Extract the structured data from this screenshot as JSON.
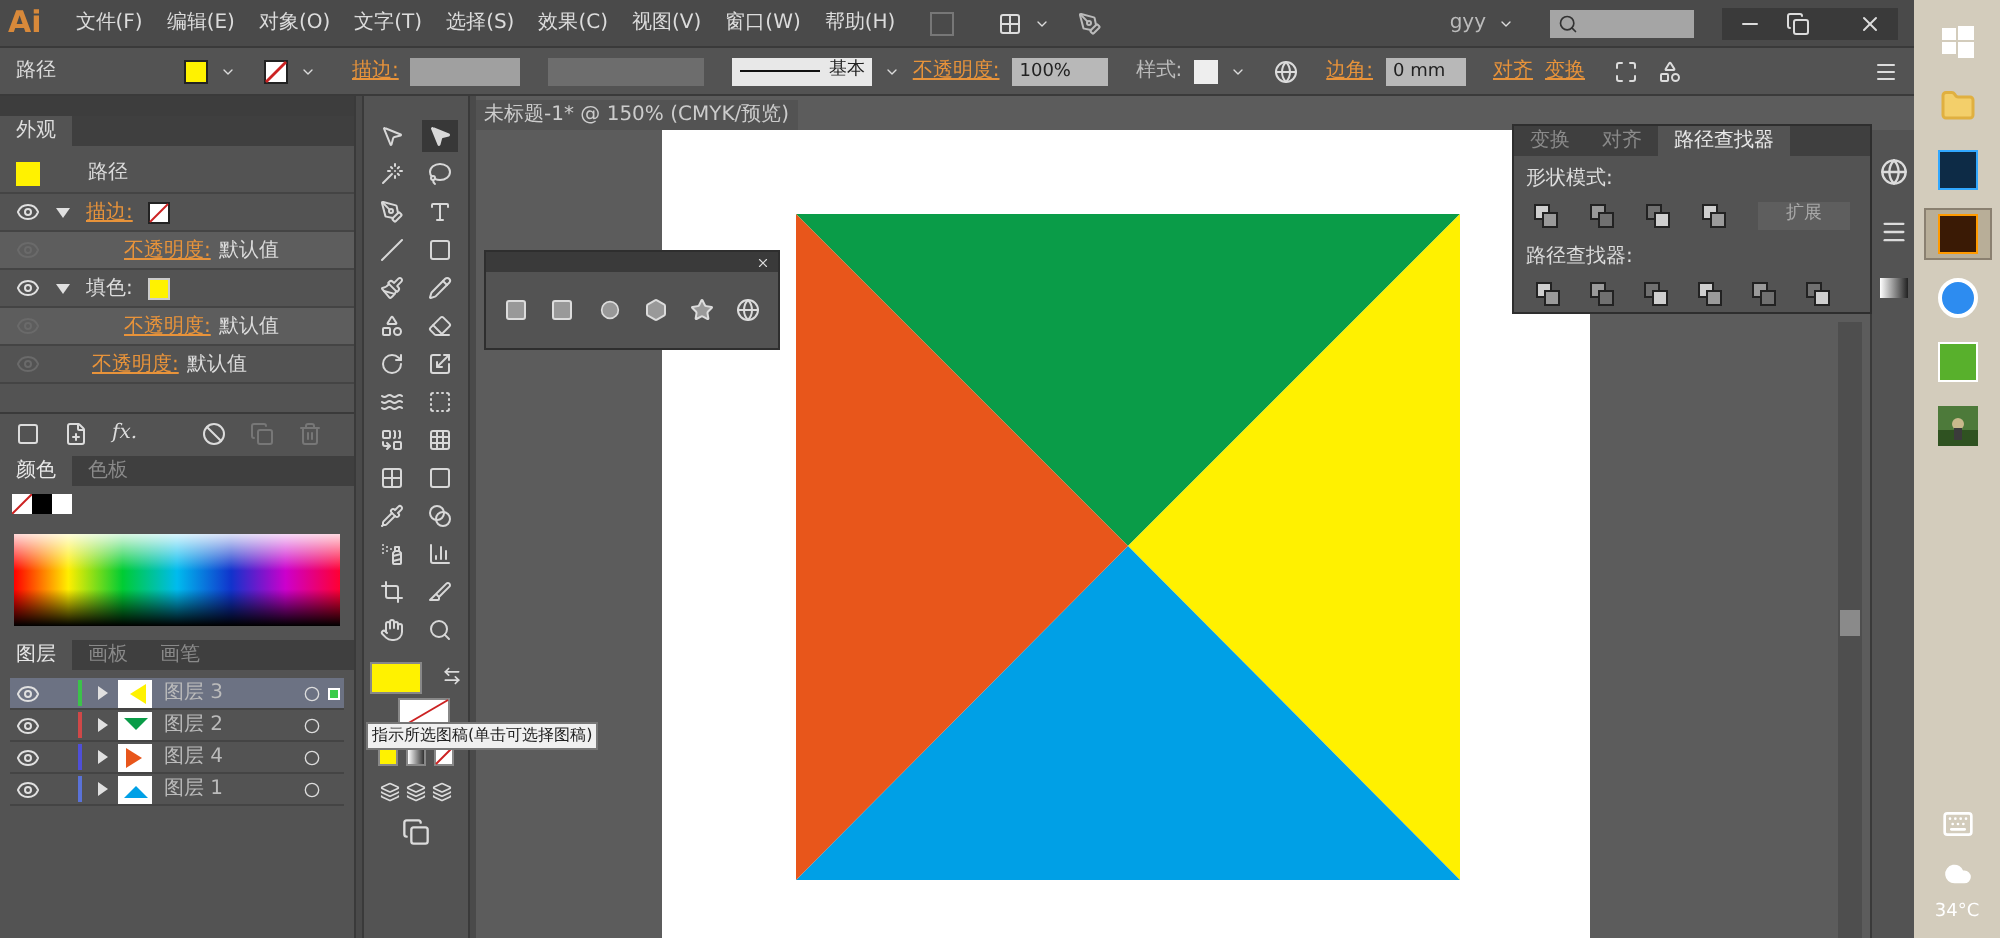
{
  "menu": {
    "logo": "Ai",
    "items": [
      "文件(F)",
      "编辑(E)",
      "对象(O)",
      "文字(T)",
      "选择(S)",
      "效果(C)",
      "视图(V)",
      "窗口(W)",
      "帮助(H)"
    ],
    "user": "gyy"
  },
  "control_bar": {
    "object_type": "路径",
    "fill_swatch": {
      "color": "#fff200"
    },
    "stroke_label": "描边:",
    "stroke_style": "基本",
    "opacity_label": "不透明度:",
    "opacity": "100%",
    "style_label": "样式:",
    "corner_label": "边角:",
    "corner": "0 mm",
    "align": "对齐",
    "transform": "变换"
  },
  "appearance": {
    "tab": "外观",
    "fx_label": "fx.",
    "rows": [
      {
        "kind": "header",
        "label": "路径",
        "color": "#fff200"
      },
      {
        "kind": "stroke",
        "label": "描边:",
        "visible": true,
        "expanded": true
      },
      {
        "kind": "sub",
        "label": "不透明度:",
        "value": "默认值",
        "visible": false
      },
      {
        "kind": "fill",
        "label": "填色:",
        "visible": true,
        "expanded": true,
        "color": "#fff200"
      },
      {
        "kind": "sub",
        "label": "不透明度:",
        "value": "默认值",
        "visible": false
      },
      {
        "kind": "opacity",
        "label": "不透明度:",
        "value": "默认值",
        "visible": false
      }
    ]
  },
  "color_panel": {
    "tabs": [
      {
        "label": "颜色",
        "selected": true
      },
      {
        "label": "色板",
        "selected": false
      }
    ]
  },
  "layers_panel": {
    "tabs": [
      {
        "label": "图层",
        "selected": true
      },
      {
        "label": "画板",
        "selected": false
      },
      {
        "label": "画笔",
        "selected": false
      }
    ],
    "layers": [
      {
        "name": "图层 3",
        "color": "#3cc34a",
        "selected": true,
        "visible": true,
        "expanded": false,
        "has_selection": true
      },
      {
        "name": "图层 2",
        "color": "#d04848",
        "selected": false,
        "visible": true,
        "expanded": false,
        "has_selection": false
      },
      {
        "name": "图层 4",
        "color": "#4f4fd8",
        "selected": false,
        "visible": true,
        "expanded": false,
        "has_selection": false
      },
      {
        "name": "图层 1",
        "color": "#5a72d8",
        "selected": false,
        "visible": true,
        "expanded": false,
        "has_selection": false
      }
    ]
  },
  "tools": [
    {
      "selected": false
    },
    {
      "selected": true
    },
    {
      "selected": false
    },
    {
      "selected": false
    },
    {
      "selected": false
    },
    {
      "selected": false
    },
    {
      "selected": false
    },
    {
      "selected": false
    },
    {
      "selected": false
    },
    {
      "selected": false
    },
    {
      "selected": false
    },
    {
      "selected": false
    },
    {
      "selected": false
    },
    {
      "selected": false
    },
    {
      "selected": false
    },
    {
      "selected": false
    },
    {
      "selected": false
    },
    {
      "selected": false
    },
    {
      "selected": false
    },
    {
      "selected": false
    },
    {
      "selected": false
    },
    {
      "selected": false
    },
    {
      "selected": false
    },
    {
      "selected": false
    },
    {
      "selected": false
    },
    {
      "selected": false
    },
    {
      "selected": false
    },
    {
      "selected": false
    }
  ],
  "fill_swatch": {
    "color": "#fff200"
  },
  "tooltip": "指示所选图稿(单击可选择图稿)",
  "document_tab": "未标题-1* @ 150% (CMYK/预览)",
  "pathfinder": {
    "tabs": [
      {
        "label": "变换",
        "selected": false
      },
      {
        "label": "对齐",
        "selected": false
      },
      {
        "label": "路径查找器",
        "selected": true
      }
    ],
    "shape_modes_label": "形状模式:",
    "expand_button": {
      "label": "扩展",
      "disabled": true
    },
    "pathfinders_label": "路径查找器:"
  },
  "taskbar": {
    "items": [
      {
        "selected": false
      },
      {
        "selected": false
      },
      {
        "selected": false
      },
      {
        "selected": true
      },
      {
        "selected": false
      },
      {
        "selected": false
      },
      {
        "selected": false
      }
    ],
    "weather": "34°C"
  }
}
